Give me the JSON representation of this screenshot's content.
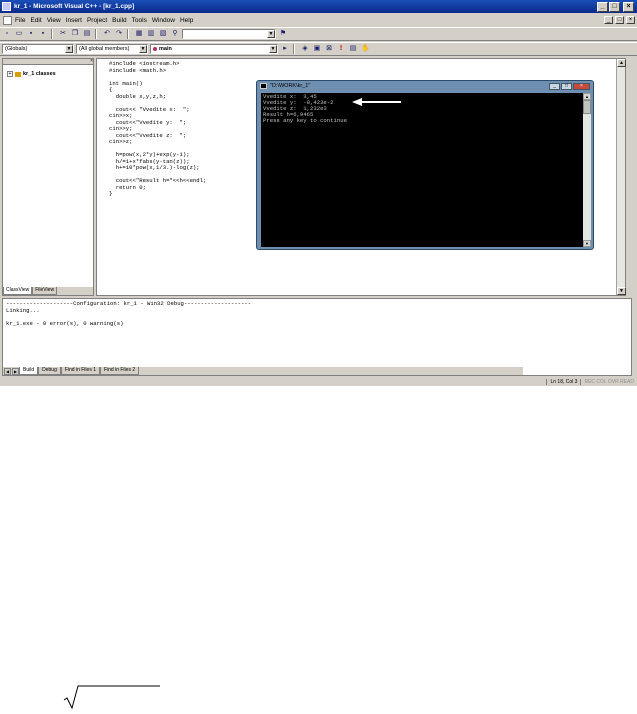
{
  "window": {
    "title": "kr_1 - Microsoft Visual C++ - [kr_1.cpp]",
    "controls": {
      "minimize": "_",
      "maximize": "□",
      "close": "×"
    }
  },
  "menu": {
    "items": [
      "File",
      "Edit",
      "View",
      "Insert",
      "Project",
      "Build",
      "Tools",
      "Window",
      "Help"
    ]
  },
  "toolbar2": {
    "scope_combo": "(Globals)",
    "members_combo": "(All global members)",
    "function_combo": "main"
  },
  "workspace": {
    "tree_root": "kr_1 classes",
    "tabs": [
      "ClassView",
      "FileView"
    ]
  },
  "editor": {
    "code": "#include <iostream.h>\n#include <math.h>\n\nint main()\n{\n  double x,y,z,h;\n\n  cout<< \"Vvedite x:  \";\ncin>>x;\n  cout<<\"Vvedite y:  \";\ncin>>y;\n  cout<<\"Vvedite z:  \";\ncin>>z;\n\n  h=pow(x,2*y)+exp(y-1);\n  h/=1+x*fabs(y-tan(z));\n  h+=10*pow(x,1/3.)-log(z);\n\n  cout<<\"Result h=\"<<h<<endl;\n  return 0;\n}"
  },
  "console": {
    "title": "\"D:\\WORK\\kr_1\"",
    "output": "Vvedite x:  3,45\nVvedite y:  -0,423e-2\nVvedite z:  1,232e3\nResult h=6,9465\nPress any key to continue"
  },
  "output_pane": {
    "text": "--------------------Configuration: kr_1 - Win32 Debug--------------------\nLinking...\n\nkr_1.exe - 0 error(s), 0 warning(s)",
    "tabs": [
      "Build",
      "Debug",
      "Find in Files 1",
      "Find in Files 2"
    ]
  },
  "status": {
    "position": "Ln 18, Col 3",
    "indicators": "REC  COL  OVR  READ"
  },
  "colors": {
    "title_bar": "#0a2a8a",
    "console_frame": "#6e8fb0",
    "console_bg": "#000000",
    "console_text": "#c0c0c0"
  }
}
